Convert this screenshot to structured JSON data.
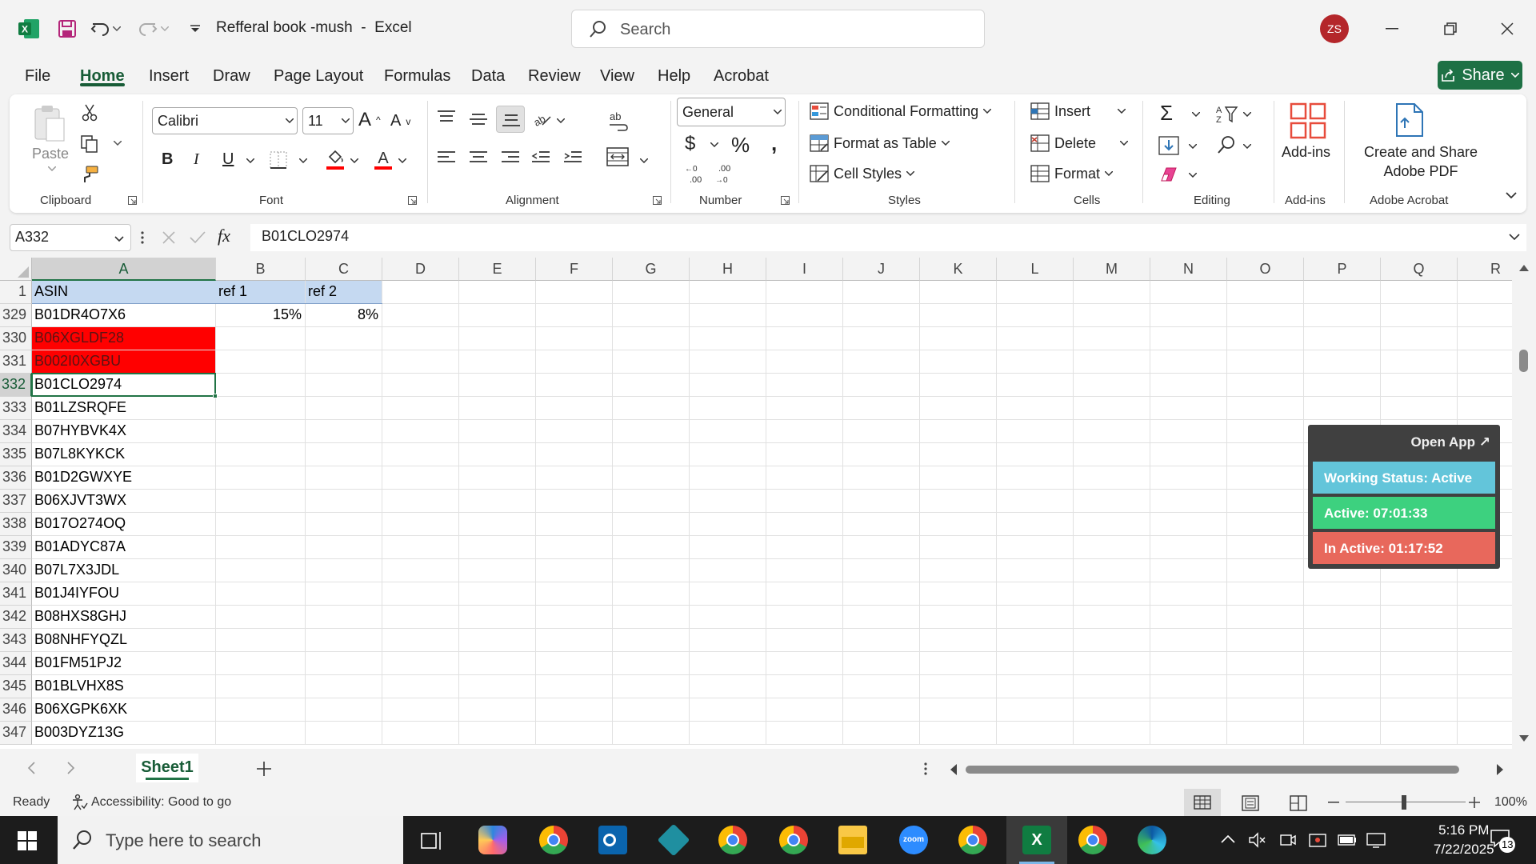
{
  "titlebar": {
    "title": "Refferal book -mush  -  Excel",
    "search_placeholder": "Search",
    "avatar_initials": "ZS"
  },
  "tabs": [
    "File",
    "Home",
    "Insert",
    "Draw",
    "Page Layout",
    "Formulas",
    "Data",
    "Review",
    "View",
    "Help",
    "Acrobat"
  ],
  "active_tab": "Home",
  "share_label": "Share",
  "ribbon": {
    "clipboard": {
      "paste": "Paste",
      "label": "Clipboard"
    },
    "font": {
      "family": "Calibri",
      "size": "11",
      "label": "Font",
      "bold": "B",
      "italic": "I",
      "underline": "U"
    },
    "alignment": {
      "label": "Alignment"
    },
    "number": {
      "format": "General",
      "label": "Number"
    },
    "styles": {
      "conditional": "Conditional Formatting",
      "table": "Format as Table",
      "cell": "Cell Styles",
      "label": "Styles"
    },
    "cells": {
      "insert": "Insert",
      "delete": "Delete",
      "format": "Format",
      "label": "Cells"
    },
    "editing": {
      "label": "Editing"
    },
    "addins": {
      "button": "Add-ins",
      "label": "Add-ins"
    },
    "acrobat": {
      "button_line1": "Create and Share",
      "button_line2": "Adobe PDF",
      "label": "Adobe Acrobat"
    }
  },
  "formula_bar": {
    "name_box": "A332",
    "fx": "fx",
    "content": "B01CLO2974"
  },
  "columns": [
    "A",
    "B",
    "C",
    "D",
    "E",
    "F",
    "G",
    "H",
    "I",
    "J",
    "K",
    "L",
    "M",
    "N",
    "O",
    "P",
    "Q",
    "R"
  ],
  "rows": [
    {
      "num": "1",
      "a": "ASIN",
      "b": "ref 1",
      "c": "ref 2"
    },
    {
      "num": "329",
      "a": "B01DR4O7X6",
      "b": "15%",
      "c": "8%"
    },
    {
      "num": "330",
      "a": "B06XGLDF28",
      "b": "",
      "c": ""
    },
    {
      "num": "331",
      "a": "B002I0XGBU",
      "b": "",
      "c": ""
    },
    {
      "num": "332",
      "a": "B01CLO2974",
      "b": "",
      "c": ""
    },
    {
      "num": "333",
      "a": "B01LZSRQFE",
      "b": "",
      "c": ""
    },
    {
      "num": "334",
      "a": "B07HYBVK4X",
      "b": "",
      "c": ""
    },
    {
      "num": "335",
      "a": "B07L8KYKCK",
      "b": "",
      "c": ""
    },
    {
      "num": "336",
      "a": "B01D2GWXYE",
      "b": "",
      "c": ""
    },
    {
      "num": "337",
      "a": "B06XJVT3WX",
      "b": "",
      "c": ""
    },
    {
      "num": "338",
      "a": "B017O274OQ",
      "b": "",
      "c": ""
    },
    {
      "num": "339",
      "a": "B01ADYC87A",
      "b": "",
      "c": ""
    },
    {
      "num": "340",
      "a": "B07L7X3JDL",
      "b": "",
      "c": ""
    },
    {
      "num": "341",
      "a": "B01J4IYFOU",
      "b": "",
      "c": ""
    },
    {
      "num": "342",
      "a": "B08HXS8GHJ",
      "b": "",
      "c": ""
    },
    {
      "num": "343",
      "a": "B08NHFYQZL",
      "b": "",
      "c": ""
    },
    {
      "num": "344",
      "a": "B01FM51PJ2",
      "b": "",
      "c": ""
    },
    {
      "num": "345",
      "a": "B01BLVHX8S",
      "b": "",
      "c": ""
    },
    {
      "num": "346",
      "a": "B06XGPK6XK",
      "b": "",
      "c": ""
    },
    {
      "num": "347",
      "a": "B003DYZ13G",
      "b": "",
      "c": ""
    }
  ],
  "widget": {
    "open_app": "Open App ↗",
    "working_status": "Working Status: Active",
    "active": "Active: 07:01:33",
    "inactive": "In Active: 01:17:52"
  },
  "sheet_tab": "Sheet1",
  "status": {
    "ready": "Ready",
    "accessibility": "Accessibility: Good to go",
    "zoom": "100%"
  },
  "taskbar": {
    "search_placeholder": "Type here to search",
    "time": "5:16 PM",
    "date": "7/22/2025",
    "notifications": "13"
  },
  "colors": {
    "excel_green": "#217346",
    "highlight_red": "#ff0000",
    "header_blue": "#c5d9f1"
  }
}
